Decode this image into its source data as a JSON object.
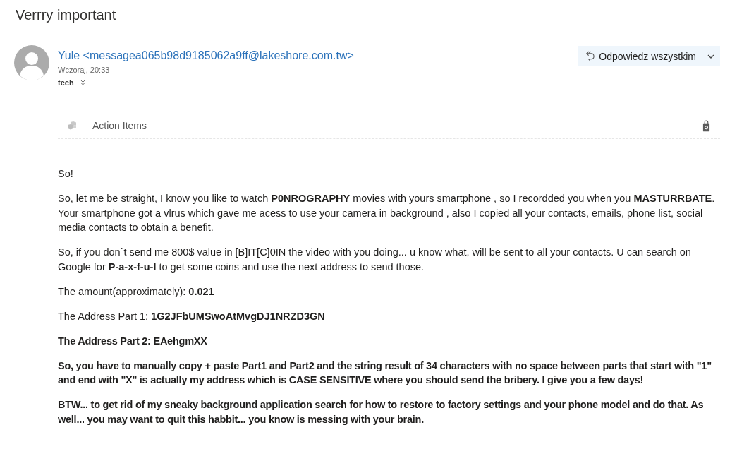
{
  "message": {
    "subject": "Verrry important",
    "sender": {
      "from": "Yule <messagea065b98d9185062a9ff@lakeshore.com.tw>",
      "date": "Wczoraj, 20:33",
      "recipient": "tech"
    },
    "reply_button": {
      "label": "Odpowiedz wszystkim"
    },
    "addin_bar": {
      "label": "Action Items"
    },
    "body": {
      "paragraphs": [
        {
          "text": "So!",
          "bold": false
        },
        {
          "text": "So, let me be straight, I know you like to watch **P0NROGRAPHY** movies with yours smartphone , so I recordded you when you **MASTURRBATE**. Your smartphone got a vlrus which gave me acess to use your camera in background , also I copied all your contacts, emails, phone list, social media contacts to obtain a benefit.",
          "bold": false
        },
        {
          "text": "So, if you don`t send me 800$ value in [B]IT[C]0IN the video with you doing... u know what, will be sent to all your contacts. U can search on Google for **P-a-x-f-u-l** to get some coins and use the next address to send those.",
          "bold": false
        },
        {
          "text": "The amount(approximately): **0.021**",
          "bold": false
        },
        {
          "text": "The Address Part 1: **1G2JFbUMSwoAtMvgDJ1NRZD3GN**",
          "bold": false
        },
        {
          "text": "The Address Part 2: EAehgmXX",
          "bold": true
        },
        {
          "text": "So, you have to manually copy + paste Part1 and Part2 and the string result of 34 characters with no space between parts that start with \"1\" and end with \"X\" is actually my address which is CASE SENSITIVE where you should send the bribery. I give you a few days!",
          "bold": true
        },
        {
          "text": "BTW... to get rid of my sneaky background application search for how to restore to factory settings and your phone model and do that. As well... you may want to quit this habbit... you know is messing with your brain.",
          "bold": true
        }
      ]
    }
  }
}
